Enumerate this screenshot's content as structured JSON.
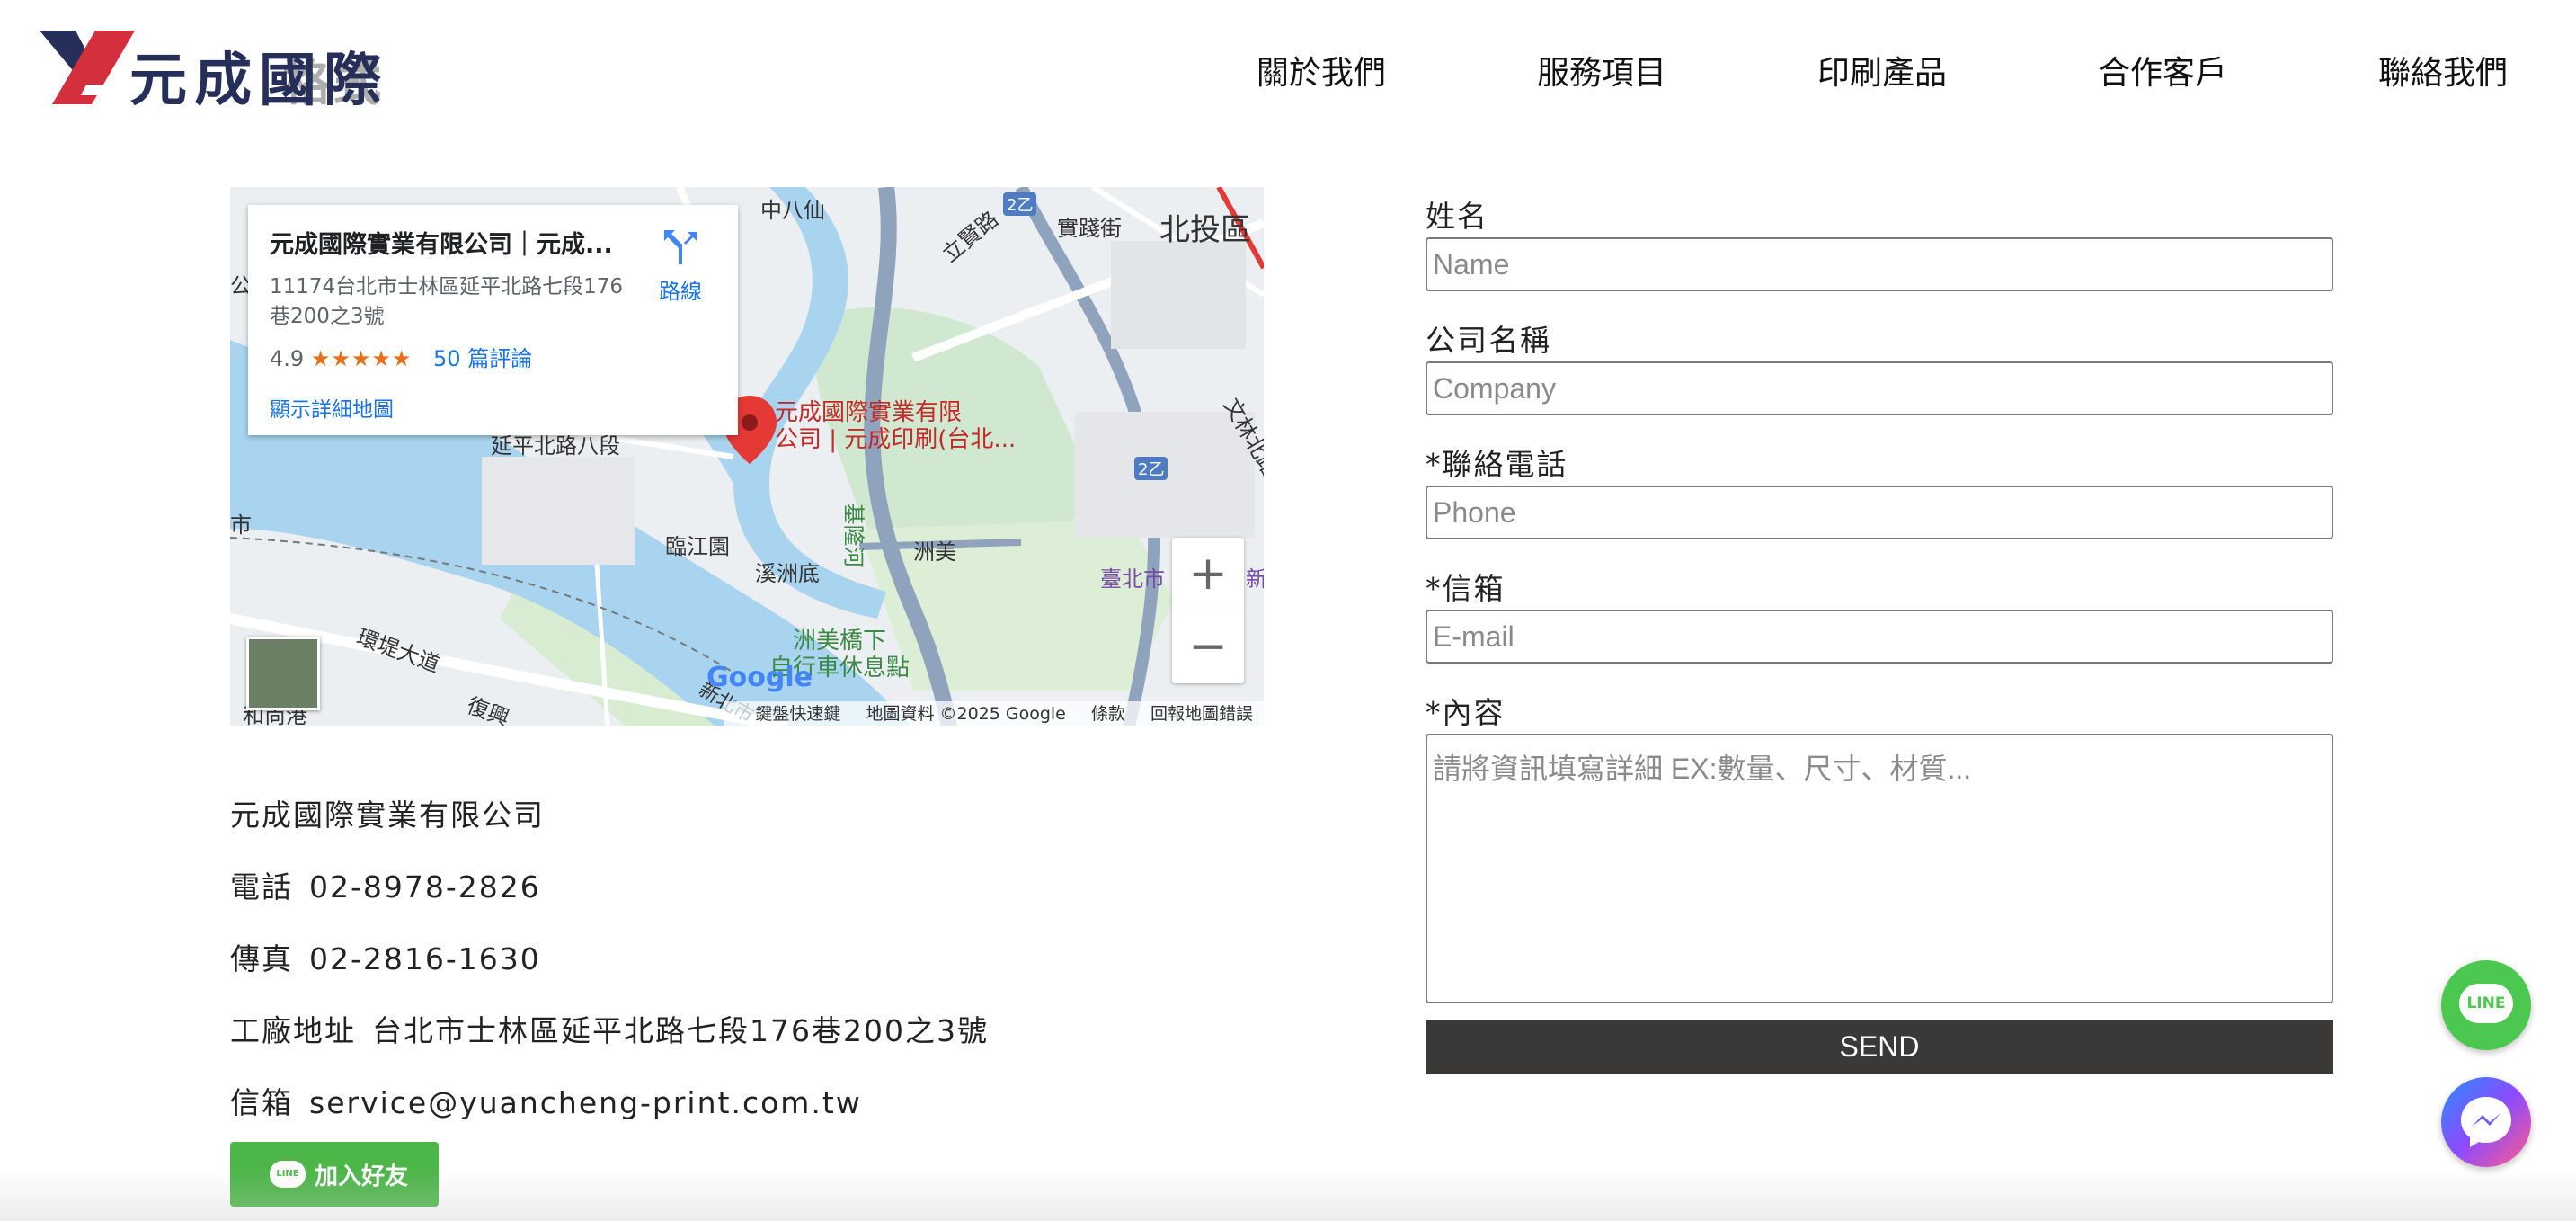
{
  "logo": {
    "text": "元成國際",
    "ghost_text": "格式"
  },
  "nav": {
    "items": [
      {
        "label": "關於我們"
      },
      {
        "label": "服務項目"
      },
      {
        "label": "印刷產品"
      },
      {
        "label": "合作客戶"
      },
      {
        "label": "聯絡我們"
      }
    ]
  },
  "map": {
    "card": {
      "title": "元成國際實業有限公司｜元成...",
      "address": "11174台北市士林區延平北路七段176巷200之3號",
      "rating": "4.9",
      "stars": "★★★★★",
      "reviews": "50 篇評論",
      "detail_link": "顯示詳細地圖",
      "directions": "路線"
    },
    "marker_label_1": "元成國際實業有限",
    "marker_label_2": "公司 | 元成印刷(台北...",
    "places": {
      "zhongbaxian": "中八仙",
      "beitou": "北投區",
      "lixian": "立賢路",
      "shijian": "實踐街",
      "wenlin": "文林北路",
      "yanping8": "延平北路八段",
      "linjiang": "臨江園",
      "xizhoudi": "溪洲底",
      "zhoumei": "洲美",
      "taipei": "臺北市",
      "xin": "新",
      "keelung_river": "基隆河",
      "bike_1": "洲美橋下",
      "bike_2": "自行車休息點",
      "huandi": "環堤大道",
      "hexiang": "和尚港",
      "fuzhou": "復興",
      "gong": "公",
      "shi": "市",
      "route_2a": "2乙",
      "route_2b": "2乙",
      "xinbei": "新北市"
    },
    "zoom_in": "+",
    "zoom_out": "−",
    "footer": {
      "shortcuts": "鍵盤快速鍵",
      "data": "地圖資料 ©2025 Google",
      "terms": "條款",
      "report": "回報地圖錯誤"
    },
    "google": "Google",
    "colors": {
      "river": "#a8d4ef",
      "park": "#cfe8cf",
      "road": "#ffffff",
      "highway": "#8fa3bd",
      "land": "#eceff1",
      "marker": "#e53935"
    }
  },
  "company": {
    "name": "元成國際實業有限公司",
    "phone_label": "電話",
    "phone": "02-8978-2826",
    "fax_label": "傳真",
    "fax": "02-2816-1630",
    "address_label": "工廠地址",
    "address": "台北市士林區延平北路七段176巷200之3號",
    "email_label": "信箱",
    "email": "service@yuancheng-print.com.tw"
  },
  "line_button": {
    "badge": "LINE",
    "label": "加入好友"
  },
  "form": {
    "name_label": "姓名",
    "name_placeholder": "Name",
    "company_label": "公司名稱",
    "company_placeholder": "Company",
    "phone_label": "*聯絡電話",
    "phone_placeholder": "Phone",
    "email_label": "*信箱",
    "email_placeholder": "E-mail",
    "content_label": "*內容",
    "content_placeholder": "請將資訊填寫詳細 EX:數量、尺寸、材質...",
    "send_label": "SEND"
  },
  "floating": {
    "line_label": "LINE",
    "line_color": "#4cc74f"
  }
}
